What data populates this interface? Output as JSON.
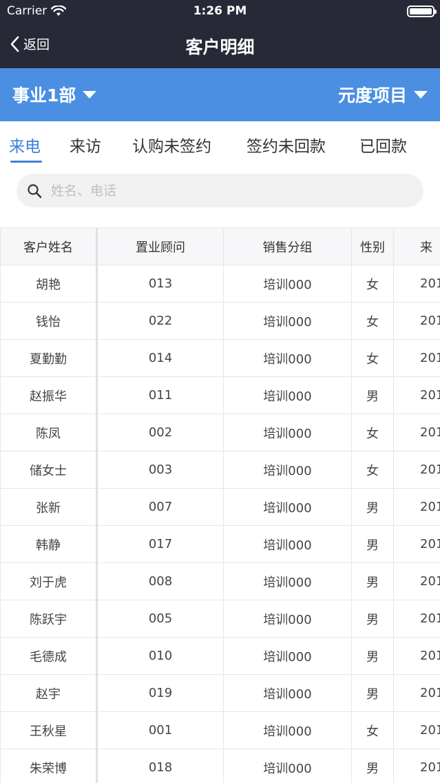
{
  "status_bar": {
    "carrier": "Carrier",
    "time": "1:26 PM"
  },
  "nav": {
    "back_label": "返回",
    "title": "客户明细"
  },
  "filters": {
    "department": "事业1部",
    "project": "元度项目"
  },
  "tabs": [
    {
      "label": "来电",
      "active": true
    },
    {
      "label": "来访",
      "active": false
    },
    {
      "label": "认购未签约",
      "active": false
    },
    {
      "label": "签约未回款",
      "active": false
    },
    {
      "label": "已回款",
      "active": false
    }
  ],
  "search": {
    "placeholder": "姓名、电话"
  },
  "colors": {
    "nav_bg": "#272a36",
    "filter_bg": "#4a8fe2",
    "accent": "#3b82d8"
  },
  "table": {
    "headers": [
      "客户姓名",
      "置业顾问",
      "销售分组",
      "性别",
      "来"
    ],
    "rows": [
      [
        "胡艳",
        "013",
        "培训000",
        "女",
        "201"
      ],
      [
        "钱怡",
        "022",
        "培训000",
        "女",
        "201"
      ],
      [
        "夏勤勤",
        "014",
        "培训000",
        "女",
        "201"
      ],
      [
        "赵振华",
        "011",
        "培训000",
        "男",
        "201"
      ],
      [
        "陈凤",
        "002",
        "培训000",
        "女",
        "201"
      ],
      [
        "储女士",
        "003",
        "培训000",
        "女",
        "201"
      ],
      [
        "张新",
        "007",
        "培训000",
        "男",
        "201"
      ],
      [
        "韩静",
        "017",
        "培训000",
        "男",
        "201"
      ],
      [
        "刘于虎",
        "008",
        "培训000",
        "男",
        "201"
      ],
      [
        "陈跃宇",
        "005",
        "培训000",
        "男",
        "201"
      ],
      [
        "毛德成",
        "010",
        "培训000",
        "男",
        "201"
      ],
      [
        "赵宇",
        "019",
        "培训000",
        "男",
        "201"
      ],
      [
        "王秋星",
        "001",
        "培训000",
        "女",
        "201"
      ],
      [
        "朱荣博",
        "018",
        "培训000",
        "男",
        "201"
      ]
    ]
  }
}
